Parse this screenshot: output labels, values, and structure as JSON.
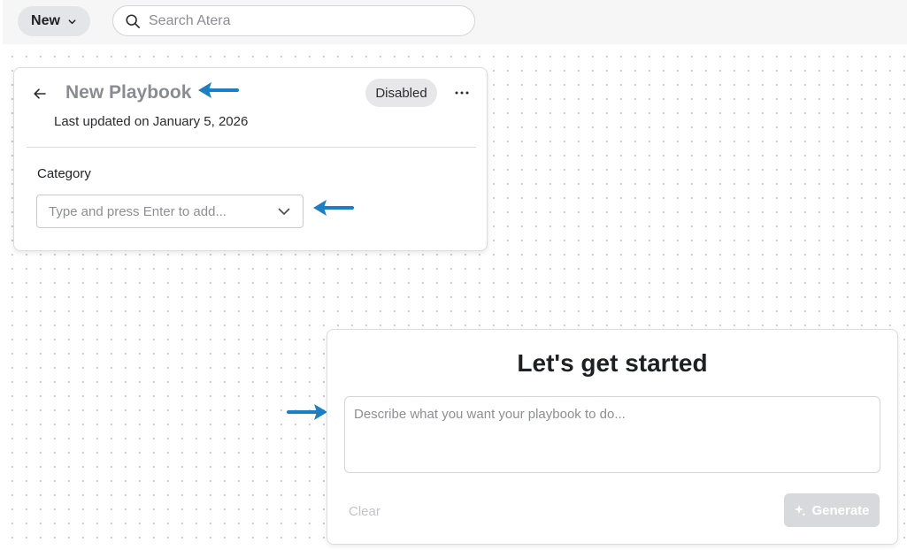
{
  "topbar": {
    "new_label": "New",
    "search_placeholder": "Search Atera"
  },
  "playbook": {
    "title": "New Playbook",
    "status": "Disabled",
    "last_updated": "Last updated on January 5, 2026",
    "category_label": "Category",
    "category_placeholder": "Type and press Enter to add..."
  },
  "generator": {
    "heading": "Let's get started",
    "prompt_placeholder": "Describe what you want your playbook to do...",
    "clear_label": "Clear",
    "generate_label": "Generate"
  },
  "icons": {
    "search": "search-icon",
    "chevron": "chevron-down-icon",
    "back": "arrow-left-icon",
    "more": "more-horizontal-icon",
    "sparkle": "sparkle-icon",
    "annotation": "arrow-pointer-icon"
  },
  "colors": {
    "annotation_arrow": "#1a7fc4",
    "title_muted": "#8a8c92",
    "badge_bg": "#e7e7ea",
    "generate_disabled_bg": "#d8d9dc"
  }
}
